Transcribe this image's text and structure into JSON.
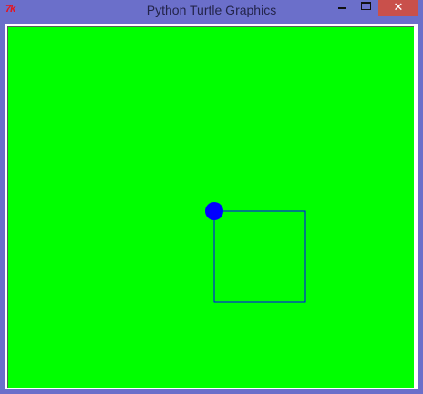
{
  "window": {
    "title": "Python Turtle Graphics",
    "app_icon_text": "7k",
    "title_bar_color": "#6b6fca",
    "close_button_color": "#c9504b",
    "minimize_icon": "minimize-icon",
    "maximize_icon": "maximize-icon",
    "close_icon": "close-icon",
    "close_glyph": "✕"
  },
  "canvas": {
    "background_color": "#00ff00",
    "square": {
      "stroke_color": "#0000ff",
      "side_length": 100
    },
    "turtle": {
      "shape": "circle",
      "fill_color": "#0000ff"
    }
  }
}
